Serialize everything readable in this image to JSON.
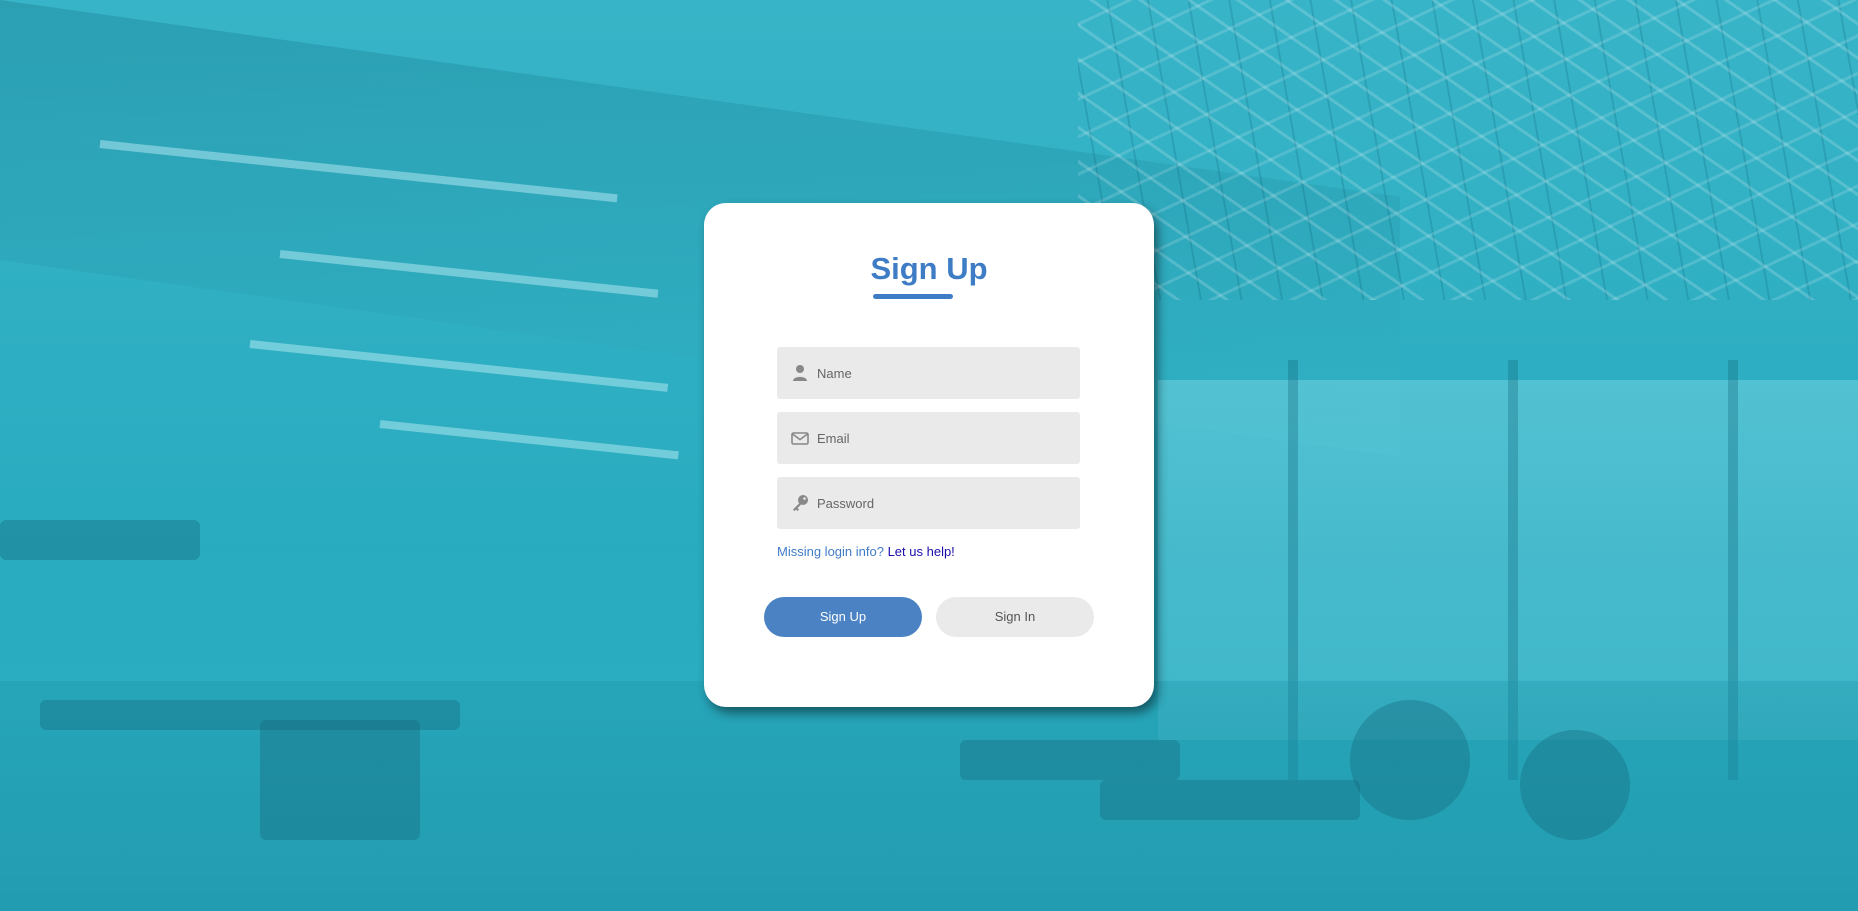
{
  "form": {
    "title": "Sign Up",
    "fields": [
      {
        "name": "name",
        "placeholder": "Name",
        "value": "",
        "icon": "user-icon"
      },
      {
        "name": "email",
        "placeholder": "Email",
        "value": "",
        "icon": "envelope-icon"
      },
      {
        "name": "password",
        "placeholder": "Password",
        "value": "",
        "icon": "key-icon"
      }
    ],
    "help_text": "Missing login info?",
    "help_link": "Let us help!",
    "primary_button": "Sign Up",
    "secondary_button": "Sign In"
  },
  "colors": {
    "accent": "#3f7cc6",
    "primary_button": "#4a82c3",
    "field_background": "#eaeaea",
    "link": "#1a0dab",
    "background_tint": "#2fb3c6"
  }
}
